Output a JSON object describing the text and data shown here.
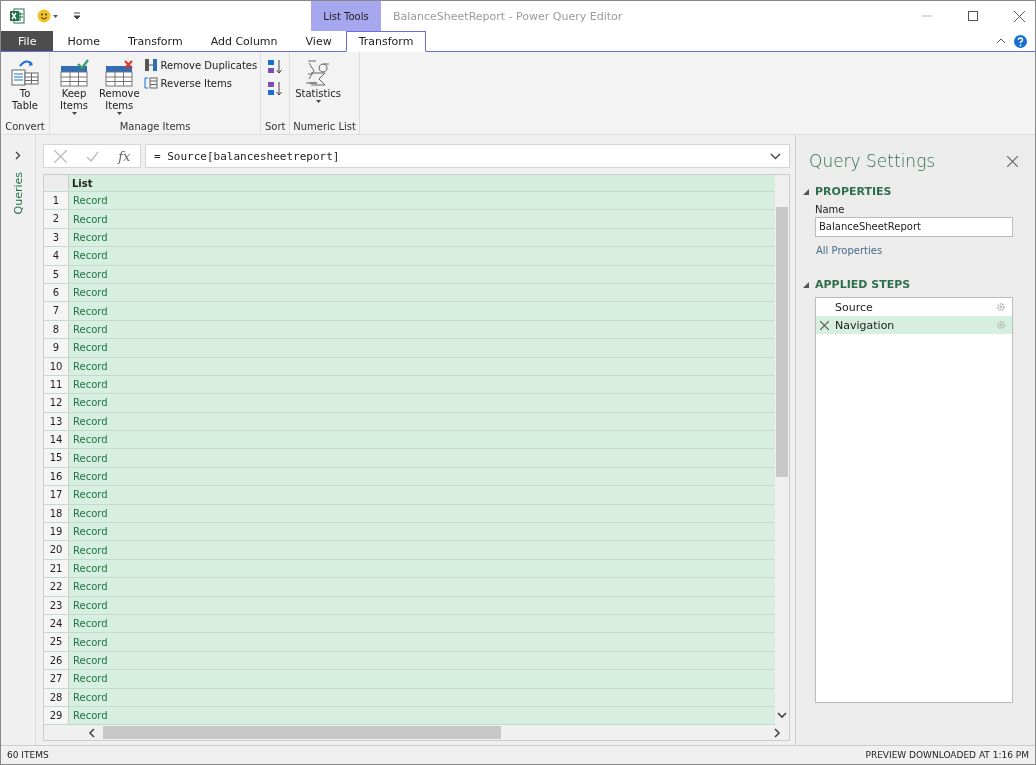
{
  "title_bar": {
    "context_group": "List Tools",
    "title": "BalanceSheetReport - Power Query Editor"
  },
  "tabs": [
    {
      "label": "File",
      "kind": "file",
      "selected": false
    },
    {
      "label": "Home",
      "kind": "tab",
      "selected": false
    },
    {
      "label": "Transform",
      "kind": "tab",
      "selected": false
    },
    {
      "label": "Add Column",
      "kind": "tab",
      "selected": false
    },
    {
      "label": "View",
      "kind": "tab",
      "selected": false
    },
    {
      "label": "Transform",
      "kind": "tab",
      "selected": true
    }
  ],
  "ribbon": [
    {
      "label": "Convert",
      "buttons": [
        {
          "kind": "large",
          "label": "To Table",
          "dropdown": false
        }
      ]
    },
    {
      "label": "Manage Items",
      "buttons": [
        {
          "kind": "large",
          "label": "Keep Items",
          "dropdown": true
        },
        {
          "kind": "large",
          "label": "Remove Items",
          "dropdown": true
        },
        {
          "kind": "small",
          "label": "Remove Duplicates"
        },
        {
          "kind": "small",
          "label": "Reverse Items"
        }
      ]
    },
    {
      "label": "Sort",
      "buttons": [
        {
          "kind": "icon"
        },
        {
          "kind": "icon"
        }
      ]
    },
    {
      "label": "Numeric List",
      "buttons": [
        {
          "kind": "large",
          "label": "Statistics",
          "dropdown": true
        }
      ]
    }
  ],
  "queries_pane": {
    "label": "Queries"
  },
  "formula_bar": {
    "fx": "fx",
    "formula": "= Source[balancesheetreport]"
  },
  "table": {
    "column": "List",
    "rows": [
      {
        "n": "1",
        "value": "Record"
      },
      {
        "n": "2",
        "value": "Record"
      },
      {
        "n": "3",
        "value": "Record"
      },
      {
        "n": "4",
        "value": "Record"
      },
      {
        "n": "5",
        "value": "Record"
      },
      {
        "n": "6",
        "value": "Record"
      },
      {
        "n": "7",
        "value": "Record"
      },
      {
        "n": "8",
        "value": "Record"
      },
      {
        "n": "9",
        "value": "Record"
      },
      {
        "n": "10",
        "value": "Record"
      },
      {
        "n": "11",
        "value": "Record"
      },
      {
        "n": "12",
        "value": "Record"
      },
      {
        "n": "13",
        "value": "Record"
      },
      {
        "n": "14",
        "value": "Record"
      },
      {
        "n": "15",
        "value": "Record"
      },
      {
        "n": "16",
        "value": "Record"
      },
      {
        "n": "17",
        "value": "Record"
      },
      {
        "n": "18",
        "value": "Record"
      },
      {
        "n": "19",
        "value": "Record"
      },
      {
        "n": "20",
        "value": "Record"
      },
      {
        "n": "21",
        "value": "Record"
      },
      {
        "n": "22",
        "value": "Record"
      },
      {
        "n": "23",
        "value": "Record"
      },
      {
        "n": "24",
        "value": "Record"
      },
      {
        "n": "25",
        "value": "Record"
      },
      {
        "n": "26",
        "value": "Record"
      },
      {
        "n": "27",
        "value": "Record"
      },
      {
        "n": "28",
        "value": "Record"
      },
      {
        "n": "29",
        "value": "Record"
      }
    ]
  },
  "query_settings": {
    "title": "Query Settings",
    "properties_heading": "PROPERTIES",
    "name_label": "Name",
    "name_value": "BalanceSheetReport",
    "all_properties": "All Properties",
    "steps_heading": "APPLIED STEPS",
    "steps": [
      {
        "name": "Source",
        "selected": false
      },
      {
        "name": "Navigation",
        "selected": true
      }
    ]
  },
  "status_bar": {
    "left": "60 ITEMS",
    "right": "PREVIEW DOWNLOADED AT 1:16 PM"
  }
}
